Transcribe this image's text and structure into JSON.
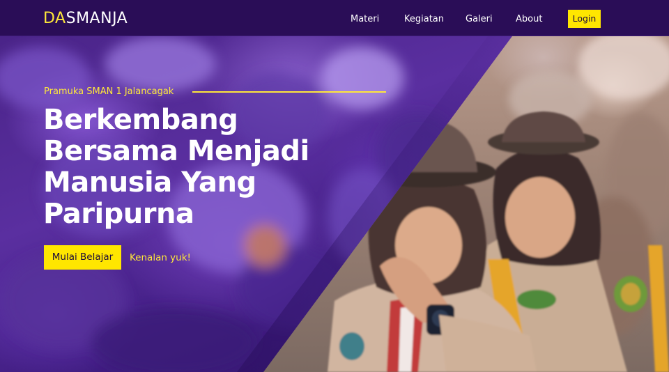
{
  "navbar": {
    "brand_accent": "DA",
    "brand_rest": "SMANJA",
    "links": [
      "Materi",
      "Kegiatan",
      "Galeri",
      "About"
    ],
    "login_label": "Login"
  },
  "hero": {
    "eyebrow": "Pramuka SMAN 1 Jalancagak",
    "headline_lines": [
      "Berkembang",
      "Bersama Menjadi",
      "Manusia Yang",
      "Paripurna"
    ],
    "primary_cta": "Mulai Belajar",
    "secondary_cta": "Kenalan yuk!"
  },
  "colors": {
    "navbar_bg": "#2a0d57",
    "accent_yellow": "#ffe600",
    "hero_purple": "#4a2488",
    "text_white": "#ffffff"
  }
}
